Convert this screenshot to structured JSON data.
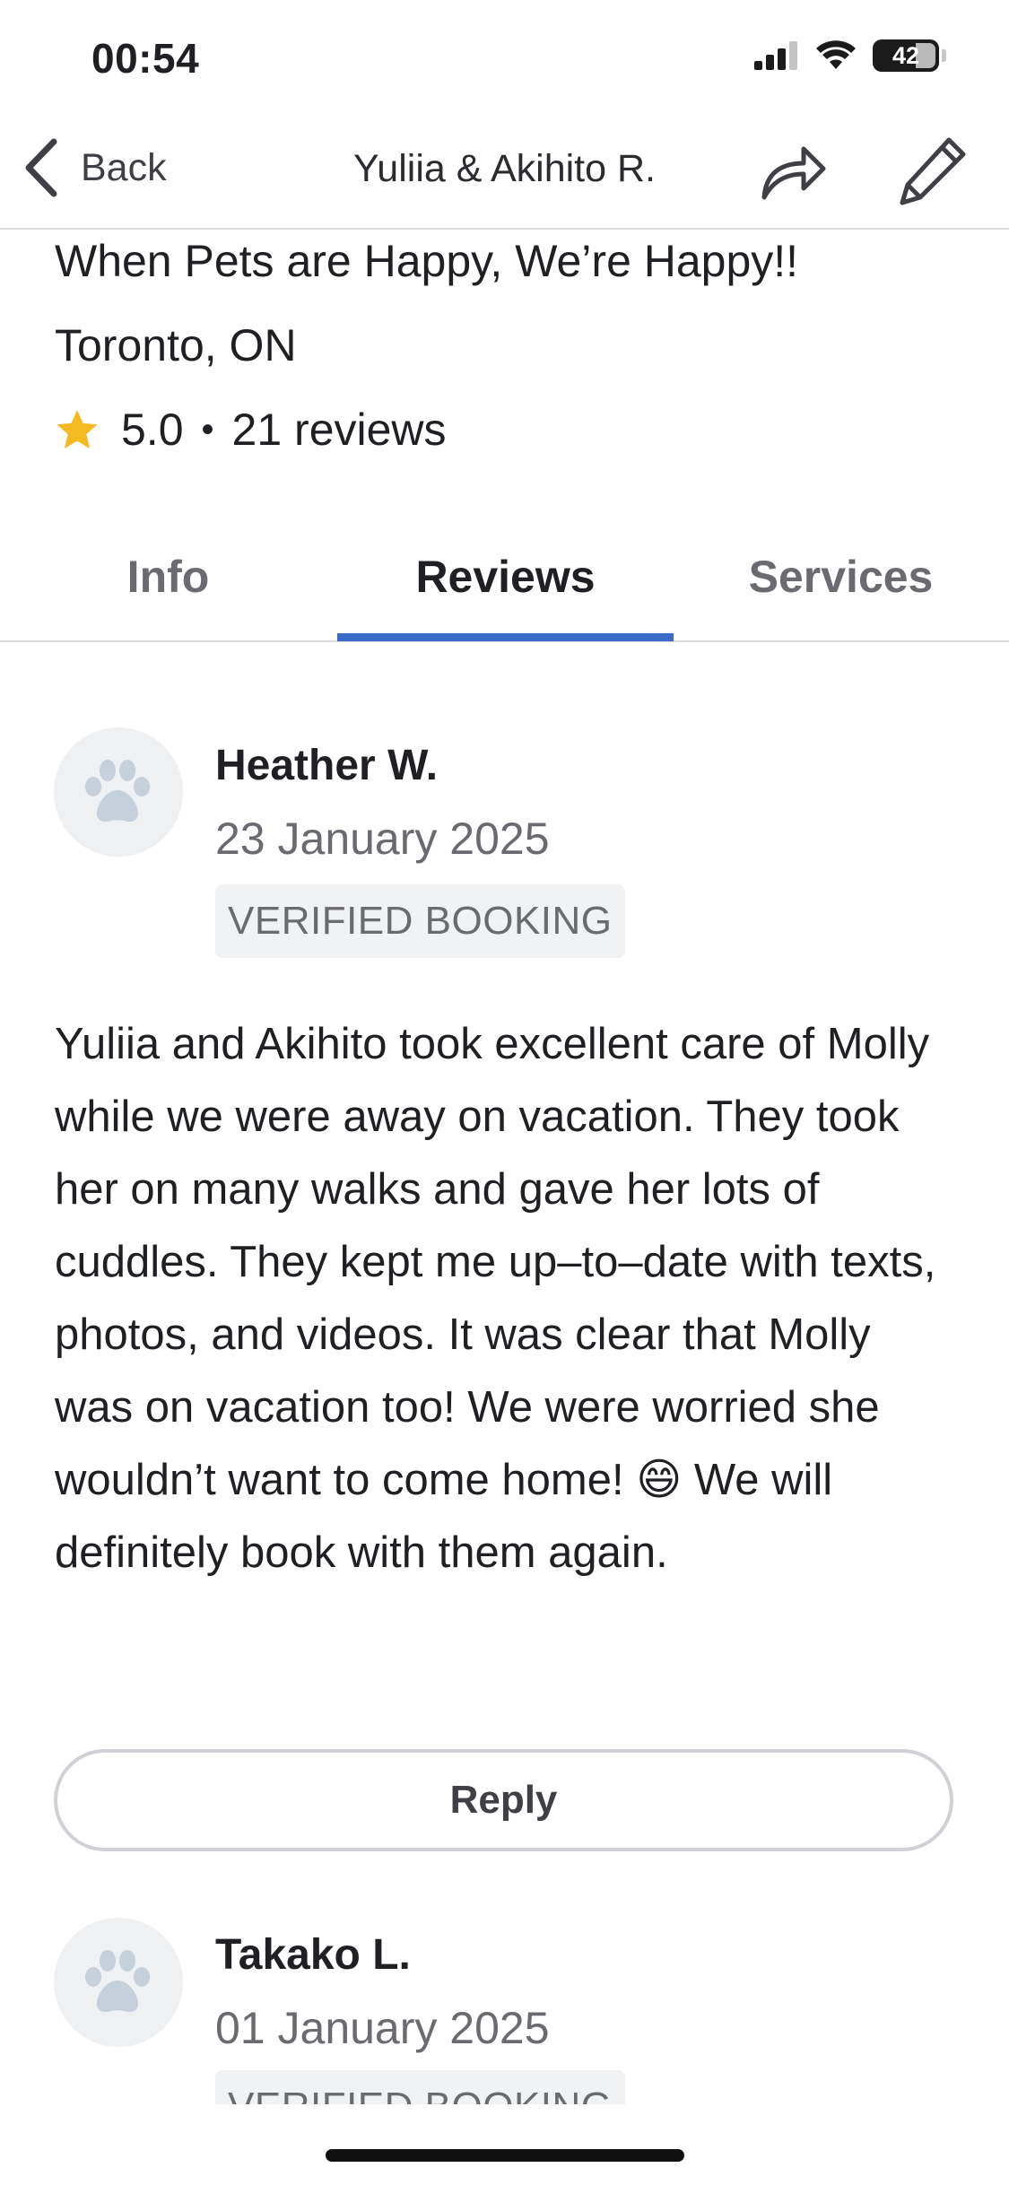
{
  "status_bar": {
    "time": "00:54",
    "battery": "42"
  },
  "nav": {
    "back_label": "Back",
    "title": "Yuliia & Akihito R."
  },
  "profile": {
    "tagline": "When Pets are Happy, We’re Happy!!",
    "location": "Toronto, ON",
    "rating": "5.0",
    "separator": "•",
    "reviews_count": "21 reviews"
  },
  "tabs": [
    {
      "label": "Info",
      "active": false
    },
    {
      "label": "Reviews",
      "active": true
    },
    {
      "label": "Services",
      "active": false
    }
  ],
  "reviews": [
    {
      "name": "Heather W.",
      "date": "23 January 2025",
      "badge": "VERIFIED BOOKING",
      "body": "Yuliia and Akihito took excellent care of Molly while we were away on vacation. They took her on many walks and gave her lots of cuddles. They kept me up–to–date with texts, photos, and videos. It was clear that Molly was on vacation too! We were worried she wouldn’t want to come home! 😄 We will definitely book with them again.",
      "reply_label": "Reply"
    },
    {
      "name": "Takako L.",
      "date": "01 January 2025",
      "badge": "VERIFIED BOOKING"
    }
  ],
  "colors": {
    "accent": "#3a6bc8",
    "star": "#f5b921",
    "avatar_bg": "#eef0f2",
    "paw": "#c5d0db"
  },
  "icons": {
    "back": "chevron-left-icon",
    "share": "share-arrow-icon",
    "edit": "pencil-icon",
    "star": "star-icon",
    "avatar": "paw-icon"
  }
}
